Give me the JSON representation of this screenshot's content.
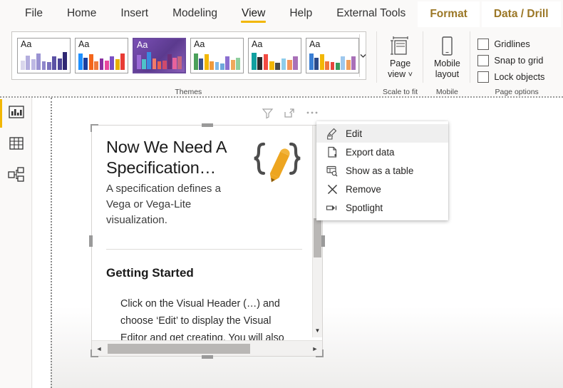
{
  "ribbon": {
    "tabs": [
      {
        "label": "File",
        "state": "normal"
      },
      {
        "label": "Home",
        "state": "normal"
      },
      {
        "label": "Insert",
        "state": "normal"
      },
      {
        "label": "Modeling",
        "state": "normal"
      },
      {
        "label": "View",
        "state": "active"
      },
      {
        "label": "Help",
        "state": "normal"
      },
      {
        "label": "External Tools",
        "state": "normal"
      },
      {
        "label": "Format",
        "state": "contextual"
      },
      {
        "label": "Data / Drill",
        "state": "contextual"
      }
    ],
    "accent_color": "#f2b705",
    "contextual_text_color": "#9b7726",
    "groups": {
      "themes": {
        "label": "Themes",
        "more_icon": "chevron-down-icon",
        "swatches": [
          {
            "name": "theme-default",
            "sample_text": "Aa",
            "dark": false,
            "selected": false,
            "bars": [
              {
                "h": 0.5,
                "c": "#d9d6ec"
              },
              {
                "h": 0.78,
                "c": "#b4aede"
              },
              {
                "h": 0.58,
                "c": "#bdb8e3"
              },
              {
                "h": 0.88,
                "c": "#9a93d2"
              },
              {
                "h": 0.46,
                "c": "#8e86cb"
              },
              {
                "h": 0.42,
                "c": "#7a71bd"
              },
              {
                "h": 0.72,
                "c": "#5b52a5"
              },
              {
                "h": 0.62,
                "c": "#4b4296"
              },
              {
                "h": 0.95,
                "c": "#2f2873"
              }
            ]
          },
          {
            "name": "theme-colorful",
            "sample_text": "Aa",
            "dark": false,
            "selected": false,
            "bars": [
              {
                "h": 0.88,
                "c": "#1e90ff"
              },
              {
                "h": 0.66,
                "c": "#1b3f9e"
              },
              {
                "h": 0.84,
                "c": "#f4661b"
              },
              {
                "h": 0.46,
                "c": "#f07a3c"
              },
              {
                "h": 0.62,
                "c": "#8b2fa0"
              },
              {
                "h": 0.5,
                "c": "#e8479e"
              },
              {
                "h": 0.74,
                "c": "#7a50c4"
              },
              {
                "h": 0.56,
                "c": "#e8b000"
              },
              {
                "h": 0.9,
                "c": "#e83b34"
              }
            ]
          },
          {
            "name": "theme-executive",
            "sample_text": "Aa",
            "dark": true,
            "selected": true,
            "bars": [
              {
                "h": 0.78,
                "c": "#9b6ad6"
              },
              {
                "h": 0.52,
                "c": "#4ec3c9"
              },
              {
                "h": 0.92,
                "c": "#3a8ce0"
              },
              {
                "h": 0.56,
                "c": "#f07a6a"
              },
              {
                "h": 0.44,
                "c": "#e8604f"
              },
              {
                "h": 0.48,
                "c": "#cf4a6c"
              },
              {
                "h": 0.82,
                "c": "#6d2f7a"
              },
              {
                "h": 0.62,
                "c": "#e8629b"
              },
              {
                "h": 0.7,
                "c": "#c4657f"
              }
            ]
          },
          {
            "name": "theme-frontier",
            "sample_text": "Aa",
            "dark": false,
            "selected": false,
            "bars": [
              {
                "h": 0.9,
                "c": "#4aa05a"
              },
              {
                "h": 0.6,
                "c": "#3a4f8a"
              },
              {
                "h": 0.84,
                "c": "#f2b705"
              },
              {
                "h": 0.46,
                "c": "#f09a3c"
              },
              {
                "h": 0.42,
                "c": "#7fb8e8"
              },
              {
                "h": 0.36,
                "c": "#6ea8dc"
              },
              {
                "h": 0.74,
                "c": "#8b6fd0"
              },
              {
                "h": 0.55,
                "c": "#f0a85c"
              },
              {
                "h": 0.66,
                "c": "#8fcf9e"
              }
            ]
          },
          {
            "name": "theme-innovate",
            "sample_text": "Aa",
            "dark": false,
            "selected": false,
            "bars": [
              {
                "h": 0.92,
                "c": "#11a0a0"
              },
              {
                "h": 0.7,
                "c": "#2b2b2b"
              },
              {
                "h": 0.86,
                "c": "#f24b42"
              },
              {
                "h": 0.48,
                "c": "#f2b705"
              },
              {
                "h": 0.4,
                "c": "#4a4a4a"
              },
              {
                "h": 0.62,
                "c": "#8ecdeb"
              },
              {
                "h": 0.54,
                "c": "#f2955c"
              },
              {
                "h": 0.72,
                "c": "#a970b8"
              }
            ]
          },
          {
            "name": "theme-bloom",
            "sample_text": "Aa",
            "dark": false,
            "selected": false,
            "bars": [
              {
                "h": 0.9,
                "c": "#3a7fd5"
              },
              {
                "h": 0.66,
                "c": "#2b4a8a"
              },
              {
                "h": 0.84,
                "c": "#f2b705"
              },
              {
                "h": 0.46,
                "c": "#f0753c"
              },
              {
                "h": 0.42,
                "c": "#e8453c"
              },
              {
                "h": 0.38,
                "c": "#3a9a5c"
              },
              {
                "h": 0.74,
                "c": "#9ec8ee"
              },
              {
                "h": 0.52,
                "c": "#f0a05c"
              },
              {
                "h": 0.72,
                "c": "#a970b8"
              }
            ]
          }
        ]
      },
      "scale_to_fit": {
        "label": "Scale to fit",
        "button": {
          "name": "page-view-button",
          "line1": "Page",
          "line2": "view",
          "icon": "page-view-icon",
          "caret": "˅"
        }
      },
      "mobile": {
        "label": "Mobile",
        "button": {
          "name": "mobile-layout-button",
          "line1": "Mobile",
          "line2": "layout",
          "icon": "phone-icon"
        }
      },
      "page_options": {
        "label": "Page options",
        "checkboxes": [
          {
            "name": "gridlines-checkbox",
            "label": "Gridlines",
            "checked": false
          },
          {
            "name": "snap-to-grid-checkbox",
            "label": "Snap to grid",
            "checked": false
          },
          {
            "name": "lock-objects-checkbox",
            "label": "Lock objects",
            "checked": false
          }
        ]
      }
    }
  },
  "left_nav": {
    "items": [
      {
        "name": "report-view",
        "icon": "bar-chart-icon",
        "active": true
      },
      {
        "name": "data-view",
        "icon": "table-icon",
        "active": false
      },
      {
        "name": "model-view",
        "icon": "model-relationship-icon",
        "active": false
      }
    ]
  },
  "visual": {
    "header_icons": [
      {
        "name": "filter-icon",
        "glyph": "filter"
      },
      {
        "name": "focus-mode-icon",
        "glyph": "focus"
      },
      {
        "name": "more-options-icon",
        "glyph": "ellipsis"
      }
    ],
    "title": "Now We Need A Specification…",
    "subtitle": "A specification defines a Vega or Vega-Lite visualization.",
    "glyph_icon": "braces-pencil-icon",
    "section_heading": "Getting Started",
    "body_text": "Click on the Visual Header (…) and choose ‘Edit’ to display the Visual Editor and get creating. You will also",
    "scroll": {
      "vertical_down_arrow": "▼",
      "horizontal_left_arrow": "◄",
      "horizontal_right_arrow": "►"
    }
  },
  "context_menu": {
    "items": [
      {
        "name": "menu-item-edit",
        "label": "Edit",
        "icon": "edit-pencil-cursor-icon",
        "hover": true
      },
      {
        "name": "menu-item-export-data",
        "label": "Export data",
        "icon": "export-page-icon",
        "hover": false
      },
      {
        "name": "menu-item-show-as-table",
        "label": "Show as a table",
        "icon": "show-as-table-icon",
        "hover": false
      },
      {
        "name": "menu-item-remove",
        "label": "Remove",
        "icon": "close-x-icon",
        "hover": false
      },
      {
        "name": "menu-item-spotlight",
        "label": "Spotlight",
        "icon": "spotlight-icon",
        "hover": false
      }
    ]
  }
}
